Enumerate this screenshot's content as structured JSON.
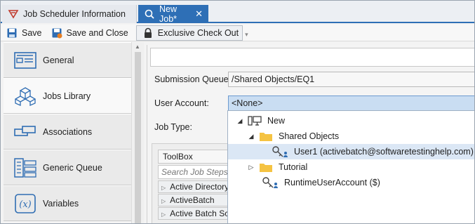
{
  "tabs": [
    {
      "label": "Job Scheduler Information",
      "icon": "scheduler-icon",
      "active": false
    },
    {
      "label": "New Job*",
      "icon": "job-icon",
      "active": true,
      "close": "✕"
    }
  ],
  "toolbar": {
    "save": "Save",
    "save_close": "Save and Close",
    "checkout": "Exclusive Check Out"
  },
  "nav": [
    {
      "label": "General",
      "icon": "general-icon"
    },
    {
      "label": "Jobs Library",
      "icon": "cubes-icon"
    },
    {
      "label": "Associations",
      "icon": "associations-icon"
    },
    {
      "label": "Generic Queue",
      "icon": "queue-icon"
    },
    {
      "label": "Variables",
      "icon": "variables-icon"
    }
  ],
  "form": {
    "name_value": "",
    "queue_label": "Submission Queue:",
    "queue_value": "/Shared Objects/EQ1",
    "account_label": "User Account:",
    "account_value": "<None>",
    "jobtype_label": "Job Type:"
  },
  "toolbox": {
    "title": "ToolBox",
    "search_placeholder": "Search Job Steps",
    "categories": [
      "Active Directory",
      "ActiveBatch",
      "Active Batch Sc"
    ]
  },
  "dropdown": {
    "items": [
      {
        "label": "New",
        "icon": "computer-icon",
        "expander": "◢",
        "level": 0
      },
      {
        "label": "Shared Objects",
        "icon": "folder-icon",
        "expander": "◢",
        "level": 1
      },
      {
        "label": "User1 (activebatch@softwaretestinghelp.com)",
        "icon": "user-key-icon",
        "expander": "",
        "level": 2,
        "selected": true
      },
      {
        "label": "Tutorial",
        "icon": "folder-icon",
        "expander": "▷",
        "level": 1
      },
      {
        "label": "RuntimeUserAccount ($)",
        "icon": "user-key-icon",
        "expander": "",
        "level": 1
      }
    ]
  },
  "colors": {
    "accent": "#2e6fb6",
    "selection": "#dbe7f5",
    "folder": "#f5c342"
  }
}
